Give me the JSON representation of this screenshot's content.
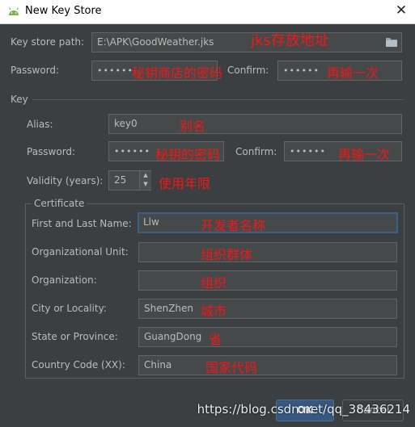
{
  "window": {
    "title": "New Key Store",
    "close_glyph": "✕",
    "icon": "android-icon"
  },
  "keystore": {
    "path_label": "Key store path:",
    "path_value": "E:\\APK\\GoodWeather.jks",
    "folder_icon": "folder-icon",
    "password_label": "Password:",
    "password_value": "••••••",
    "confirm_label": "Confirm:",
    "confirm_value": "••••••"
  },
  "key": {
    "section_label": "Key",
    "alias_label": "Alias:",
    "alias_value": "key0",
    "password_label": "Password:",
    "password_value": "••••••",
    "confirm_label": "Confirm:",
    "confirm_value": "••••••",
    "validity_label": "Validity (years):",
    "validity_value": "25"
  },
  "certificate": {
    "legend": "Certificate",
    "fields": [
      {
        "label": "First and Last Name:",
        "value": "Llw"
      },
      {
        "label": "Organizational Unit:",
        "value": ""
      },
      {
        "label": "Organization:",
        "value": ""
      },
      {
        "label": "City or Locality:",
        "value": "ShenZhen"
      },
      {
        "label": "State or Province:",
        "value": "GuangDong"
      },
      {
        "label": "Country Code (XX):",
        "value": "China"
      }
    ]
  },
  "annotations": {
    "path": "jks存放地址",
    "store_password": "秘钥商店的密码",
    "store_confirm": "再输一次",
    "alias": "别名",
    "key_password": "秘钥的密码",
    "key_confirm": "再输一次",
    "validity": "使用年限",
    "name": "开发者名称",
    "org_unit": "组织群体",
    "org": "组织",
    "city": "城市",
    "state": "省",
    "country": "国家代码"
  },
  "buttons": {
    "ok": "OK",
    "cancel": "Cancel"
  },
  "watermark": "https://blog.csdn.net/qq_38436214",
  "colors": {
    "background": "#3c3f41",
    "field_bg": "#45494a",
    "text": "#bbbbbb",
    "annotation": "#f01818",
    "focus": "#3d6185"
  }
}
